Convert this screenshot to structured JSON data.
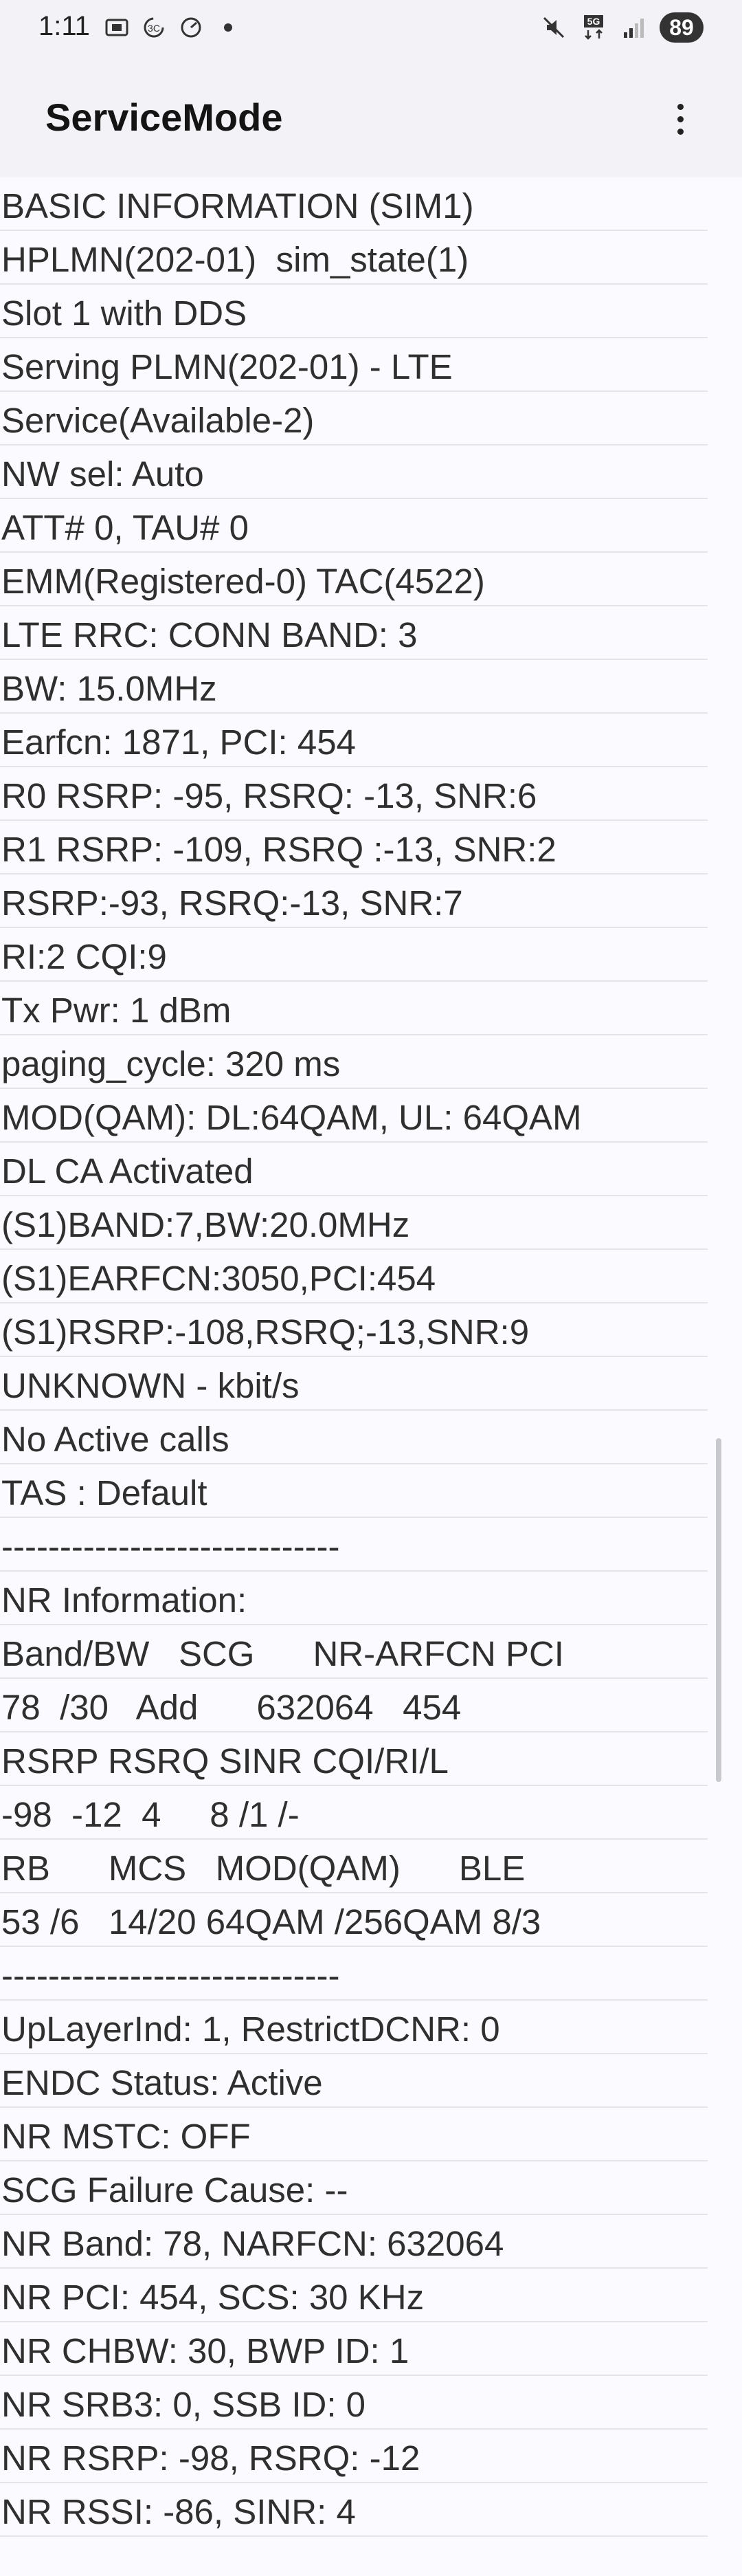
{
  "status_bar": {
    "time": "1:11",
    "left_icons": [
      "screenshot-icon",
      "data-saver-icon",
      "speed-icon",
      "dot-icon"
    ],
    "right_icons": [
      "mute-icon",
      "5g-network-icon",
      "signal-icon"
    ],
    "battery": "89"
  },
  "app_bar": {
    "title": "ServiceMode"
  },
  "rows": [
    "BASIC INFORMATION (SIM1)",
    "HPLMN(202-01)  sim_state(1)",
    "Slot 1 with DDS",
    "Serving PLMN(202-01) - LTE",
    "Service(Available-2)",
    "NW sel: Auto",
    "ATT# 0, TAU# 0",
    "EMM(Registered-0) TAC(4522)",
    "LTE RRC: CONN BAND: 3",
    "BW: 15.0MHz",
    "Earfcn: 1871, PCI: 454",
    "R0 RSRP: -95, RSRQ: -13, SNR:6",
    "R1 RSRP: -109, RSRQ :-13, SNR:2",
    "RSRP:-93, RSRQ:-13, SNR:7",
    "RI:2 CQI:9",
    "Tx Pwr: 1 dBm",
    "paging_cycle: 320 ms",
    "MOD(QAM): DL:64QAM, UL: 64QAM",
    "DL CA Activated",
    "(S1)BAND:7,BW:20.0MHz",
    "(S1)EARFCN:3050,PCI:454",
    "(S1)RSRP:-108,RSRQ;-13,SNR:9",
    "UNKNOWN - kbit/s",
    "No Active calls",
    "TAS : Default",
    "-----------------------------",
    "NR Information:",
    "Band/BW   SCG      NR-ARFCN PCI",
    "78  /30   Add      632064   454",
    "RSRP RSRQ SINR CQI/RI/L",
    "-98  -12  4     8 /1 /-",
    "RB      MCS   MOD(QAM)      BLE",
    "53 /6   14/20 64QAM /256QAM 8/3",
    "-----------------------------",
    "UpLayerInd: 1, RestrictDCNR: 0",
    "ENDC Status: Active",
    "NR MSTC: OFF",
    "SCG Failure Cause: --",
    "NR Band: 78, NARFCN: 632064",
    "NR PCI: 454, SCS: 30 KHz",
    "NR CHBW: 30, BWP ID: 1",
    "NR SRB3: 0, SSB ID: 0",
    "NR RSRP: -98, RSRQ: -12",
    "NR RSSI: -86, SINR: 4"
  ]
}
